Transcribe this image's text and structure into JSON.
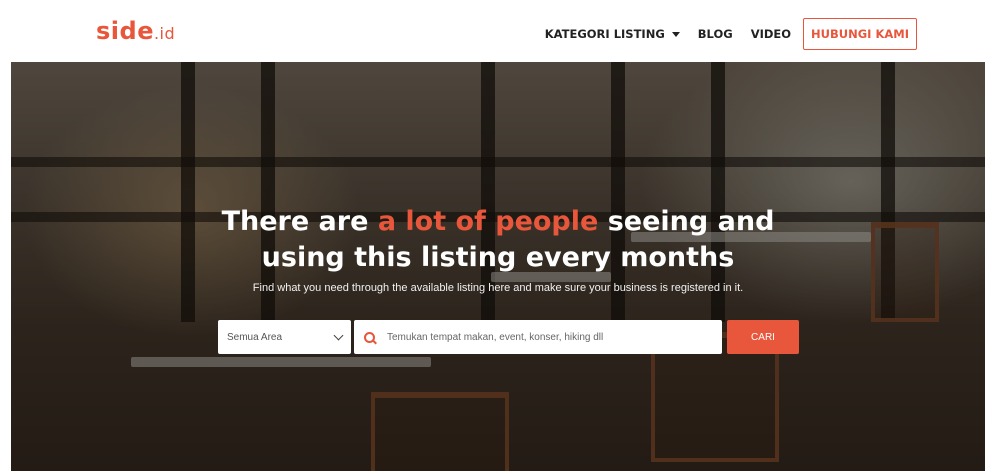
{
  "brand": {
    "logo_main": "side",
    "logo_suffix": ".id",
    "color": "#e8563b"
  },
  "nav": {
    "items": [
      {
        "label": "KATEGORI LISTING",
        "has_dropdown": true
      },
      {
        "label": "BLOG"
      },
      {
        "label": "VIDEO"
      }
    ],
    "cta_label": "HUBUNGI KAMI"
  },
  "hero": {
    "title_part1": "There are ",
    "title_accent": "a lot of people",
    "title_part2": " seeing and",
    "title_line2": "using this listing every months",
    "subtitle": "Find what you need through the available listing here and make sure your business is registered in it.",
    "area_select": "Semua Area",
    "search_placeholder": "Temukan tempat makan, event, konser, hiking dll",
    "search_button": "CARI"
  },
  "icons": {
    "search": "search-icon",
    "dropdown": "chevron-down-icon"
  }
}
